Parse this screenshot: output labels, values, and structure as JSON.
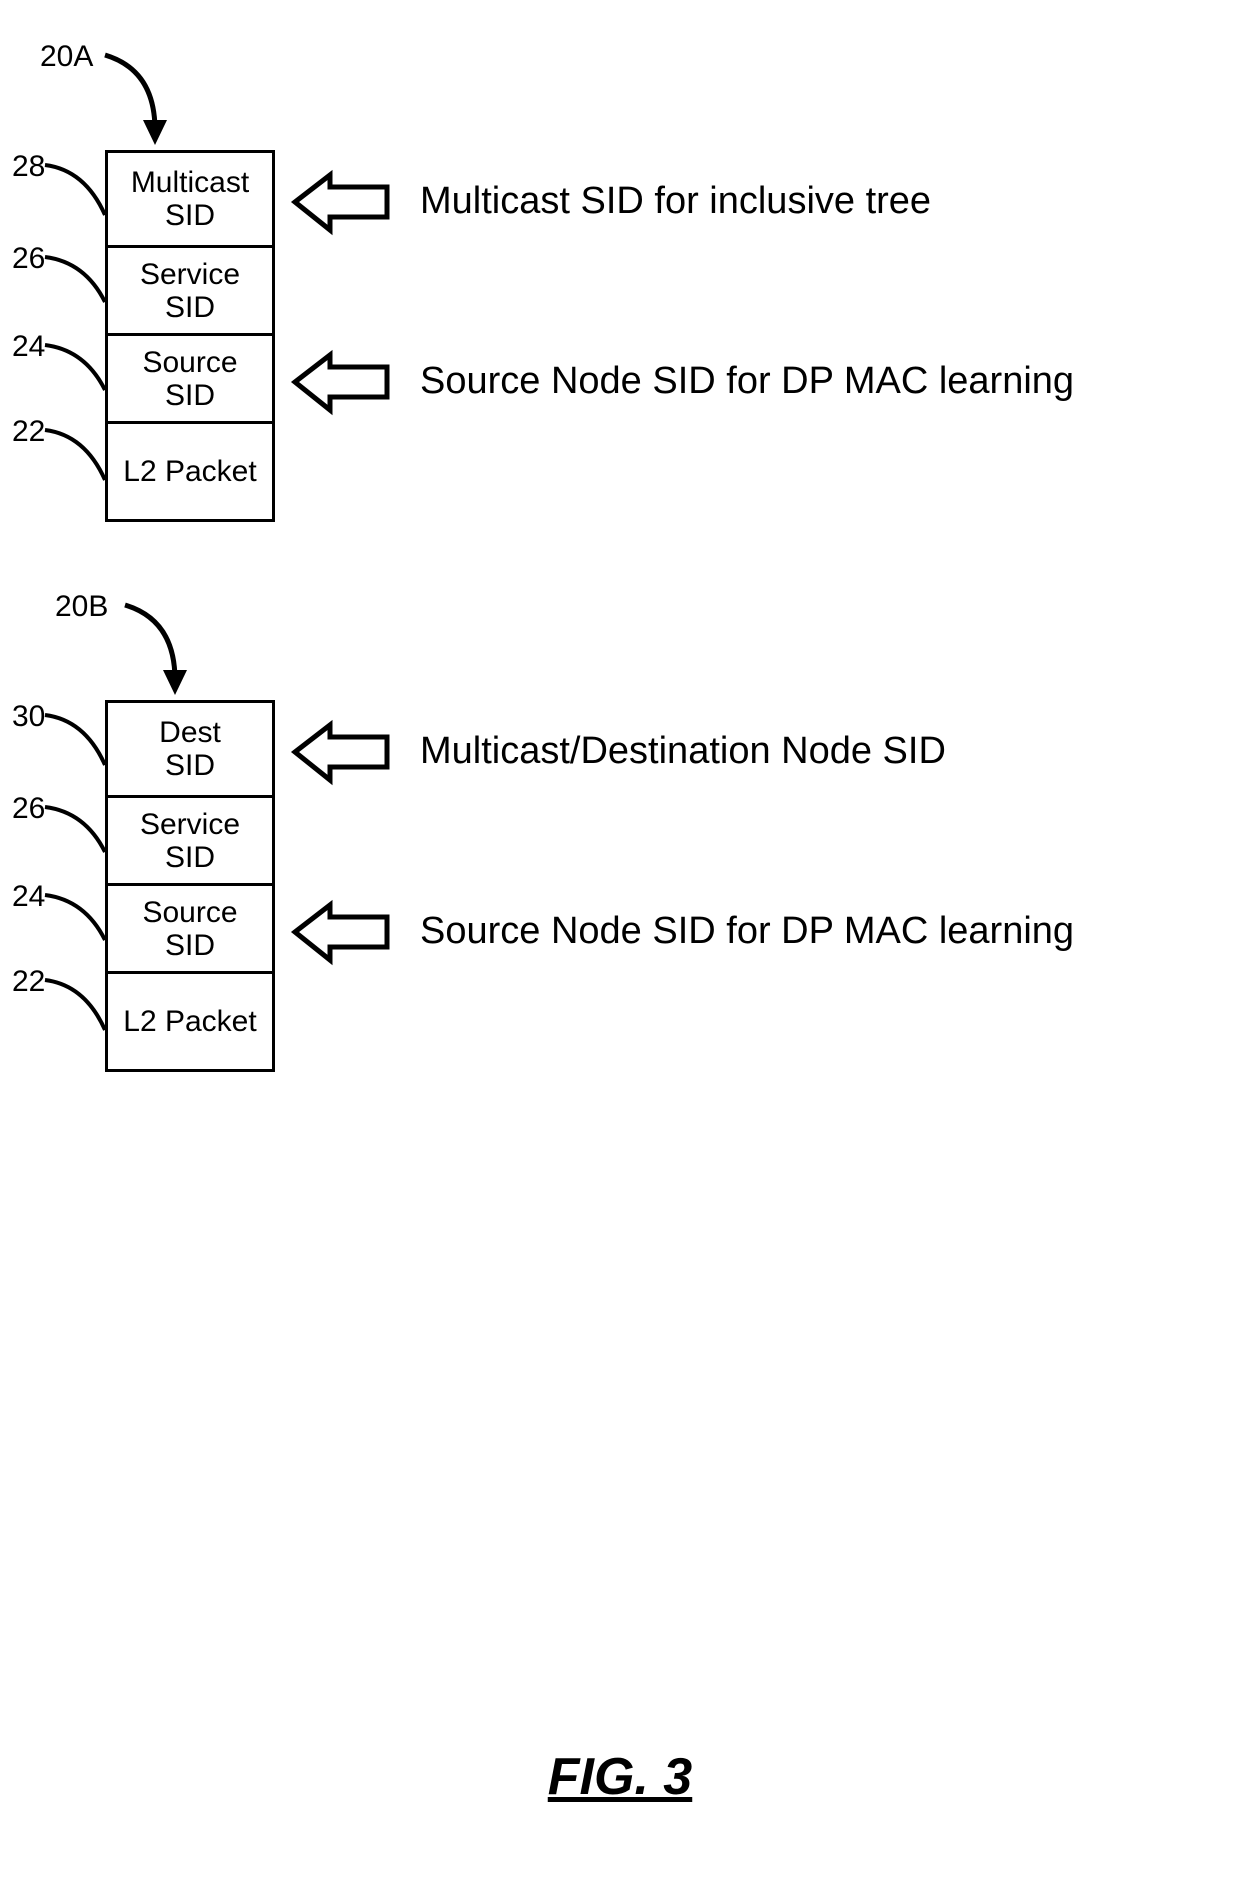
{
  "figure_caption": "FIG. 3",
  "diagram_a": {
    "id_label": "20A",
    "layers": {
      "top": {
        "line1": "Multicast",
        "line2": "SID",
        "ref": "28"
      },
      "second": {
        "line1": "Service",
        "line2": "SID",
        "ref": "26"
      },
      "third": {
        "line1": "Source",
        "line2": "SID",
        "ref": "24"
      },
      "bottom": {
        "line1": "L2 Packet",
        "line2": "",
        "ref": "22"
      }
    },
    "annotations": {
      "top": "Multicast SID for inclusive tree",
      "third": "Source Node SID for DP MAC learning"
    }
  },
  "diagram_b": {
    "id_label": "20B",
    "layers": {
      "top": {
        "line1": "Dest",
        "line2": "SID",
        "ref": "30"
      },
      "second": {
        "line1": "Service",
        "line2": "SID",
        "ref": "26"
      },
      "third": {
        "line1": "Source",
        "line2": "SID",
        "ref": "24"
      },
      "bottom": {
        "line1": "L2 Packet",
        "line2": "",
        "ref": "22"
      }
    },
    "annotations": {
      "top": "Multicast/Destination Node SID",
      "third": "Source Node SID for DP MAC learning"
    }
  }
}
